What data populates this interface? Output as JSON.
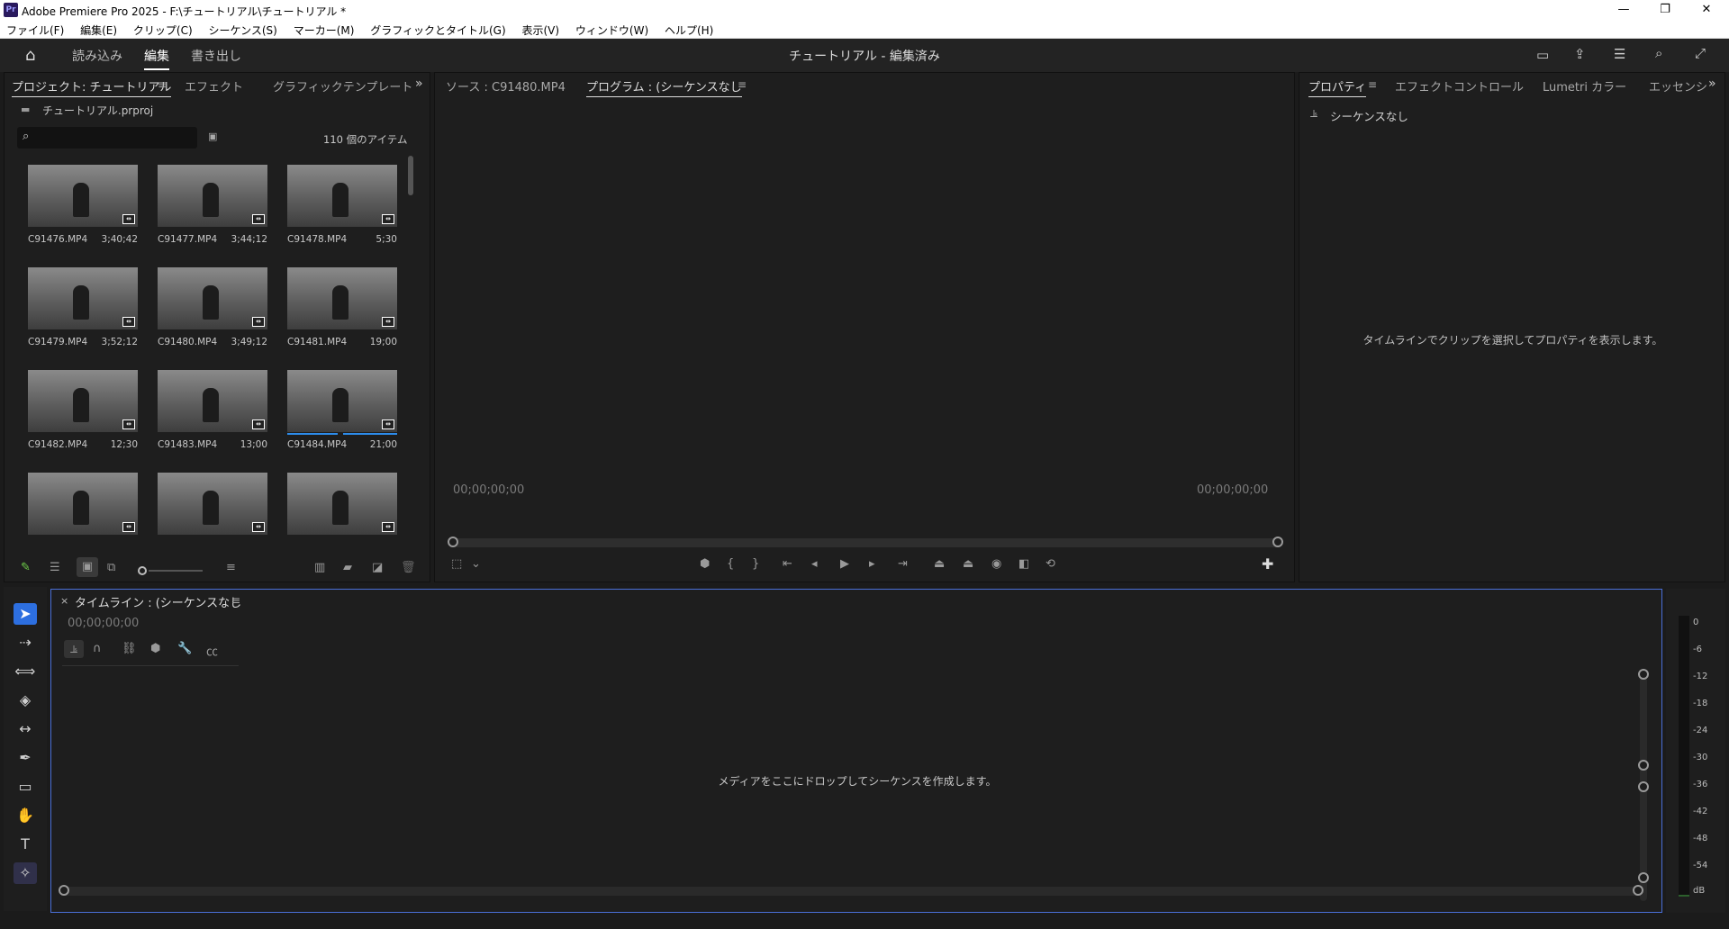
{
  "window": {
    "title": "Adobe Premiere Pro 2025 - F:\\チュートリアル\\チュートリアル *",
    "logo": "Pr"
  },
  "menu": [
    "ファイル(F)",
    "編集(E)",
    "クリップ(C)",
    "シーケンス(S)",
    "マーカー(M)",
    "グラフィックとタイトル(G)",
    "表示(V)",
    "ウィンドウ(W)",
    "ヘルプ(H)"
  ],
  "workspaces": {
    "import": "読み込み",
    "edit": "編集",
    "export": "書き出し",
    "project_title": "チュートリアル - 編集済み"
  },
  "project_panel": {
    "tabs": [
      "プロジェクト: チュートリアル",
      "エフェクト",
      "グラフィックテンプレート"
    ],
    "file": "チュートリアル.prproj",
    "search_placeholder": "",
    "item_count": "110 個のアイテム",
    "clips": [
      {
        "name": "C91476.MP4",
        "duration": "3;40;42"
      },
      {
        "name": "C91477.MP4",
        "duration": "3;44;12"
      },
      {
        "name": "C91478.MP4",
        "duration": "5;30"
      },
      {
        "name": "C91479.MP4",
        "duration": "3;52;12"
      },
      {
        "name": "C91480.MP4",
        "duration": "3;49;12"
      },
      {
        "name": "C91481.MP4",
        "duration": "19;00"
      },
      {
        "name": "C91482.MP4",
        "duration": "12;30"
      },
      {
        "name": "C91483.MP4",
        "duration": "13;00"
      },
      {
        "name": "C91484.MP4",
        "duration": "21;00"
      }
    ]
  },
  "monitor": {
    "source_tab": "ソース : C91480.MP4",
    "program_tab": "プログラム : (シーケンスなし",
    "timecode_left": "00;00;00;00",
    "timecode_right": "00;00;00;00"
  },
  "properties_panel": {
    "tabs": [
      "プロパティ",
      "エフェクトコントロール",
      "Lumetri カラー",
      "エッセンシ"
    ],
    "sequence": "シーケンスなし",
    "empty_message": "タイムラインでクリップを選択してプロパティを表示します。"
  },
  "timeline": {
    "close": "×",
    "tab": "タイムライン : (シーケンスなし",
    "timecode": "00;00;00;00",
    "empty_message": "メディアをここにドロップしてシーケンスを作成します。"
  },
  "audio_meter": {
    "labels": [
      "0",
      "-6",
      "-12",
      "-18",
      "-24",
      "-30",
      "-36",
      "-42",
      "-48",
      "-54",
      "dB"
    ]
  },
  "colors": {
    "accent": "#2d8ceb",
    "selection": "#4a6fd8"
  }
}
